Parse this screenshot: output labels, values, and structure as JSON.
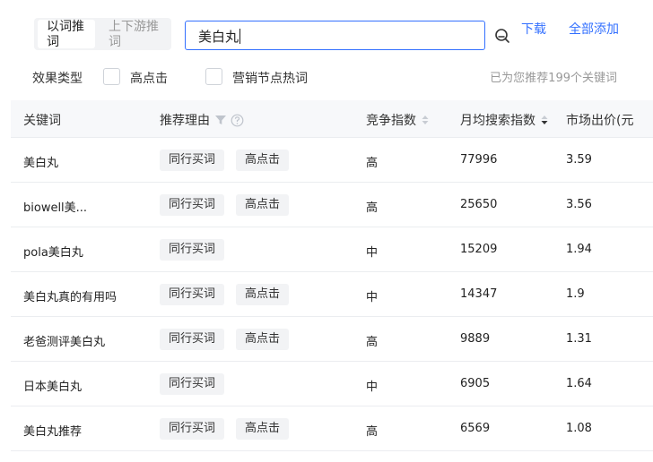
{
  "mode_tabs": [
    {
      "label": "以词推词",
      "active": true
    },
    {
      "label": "上下游推词",
      "active": false
    }
  ],
  "search": {
    "value": "美白丸"
  },
  "actions": {
    "download": "下载",
    "add_all": "全部添加"
  },
  "filters": {
    "label": "效果类型",
    "options": [
      {
        "label": "高点击",
        "checked": false
      },
      {
        "label": "营销节点热词",
        "checked": false
      }
    ]
  },
  "recommend_summary": "已为您推荐199个关键词",
  "table": {
    "columns": {
      "keyword": "关键词",
      "reason": "推荐理由",
      "competition": "竞争指数",
      "monthly_search": "月均搜索指数",
      "price": "市场出价(元"
    },
    "sort": {
      "column": "monthly_search",
      "direction": "desc"
    },
    "rows": [
      {
        "keyword": "美白丸",
        "tags": [
          "同行买词",
          "高点击"
        ],
        "competition": "高",
        "monthly_search": "77996",
        "price": "3.59"
      },
      {
        "keyword": "biowell美...",
        "tags": [
          "同行买词",
          "高点击"
        ],
        "competition": "高",
        "monthly_search": "25650",
        "price": "3.56"
      },
      {
        "keyword": "pola美白丸",
        "tags": [
          "同行买词"
        ],
        "competition": "中",
        "monthly_search": "15209",
        "price": "1.94"
      },
      {
        "keyword": "美白丸真的有用吗",
        "tags": [
          "同行买词",
          "高点击"
        ],
        "competition": "中",
        "monthly_search": "14347",
        "price": "1.9"
      },
      {
        "keyword": "老爸测评美白丸",
        "tags": [
          "同行买词",
          "高点击"
        ],
        "competition": "高",
        "monthly_search": "9889",
        "price": "1.31"
      },
      {
        "keyword": "日本美白丸",
        "tags": [
          "同行买词"
        ],
        "competition": "中",
        "monthly_search": "6905",
        "price": "1.64"
      },
      {
        "keyword": "美白丸推荐",
        "tags": [
          "同行买词",
          "高点击"
        ],
        "competition": "高",
        "monthly_search": "6569",
        "price": "1.08"
      }
    ]
  },
  "colors": {
    "accent": "#3370ff",
    "header_bg": "#f7f8fa",
    "tag_bg": "#f2f3f5"
  }
}
